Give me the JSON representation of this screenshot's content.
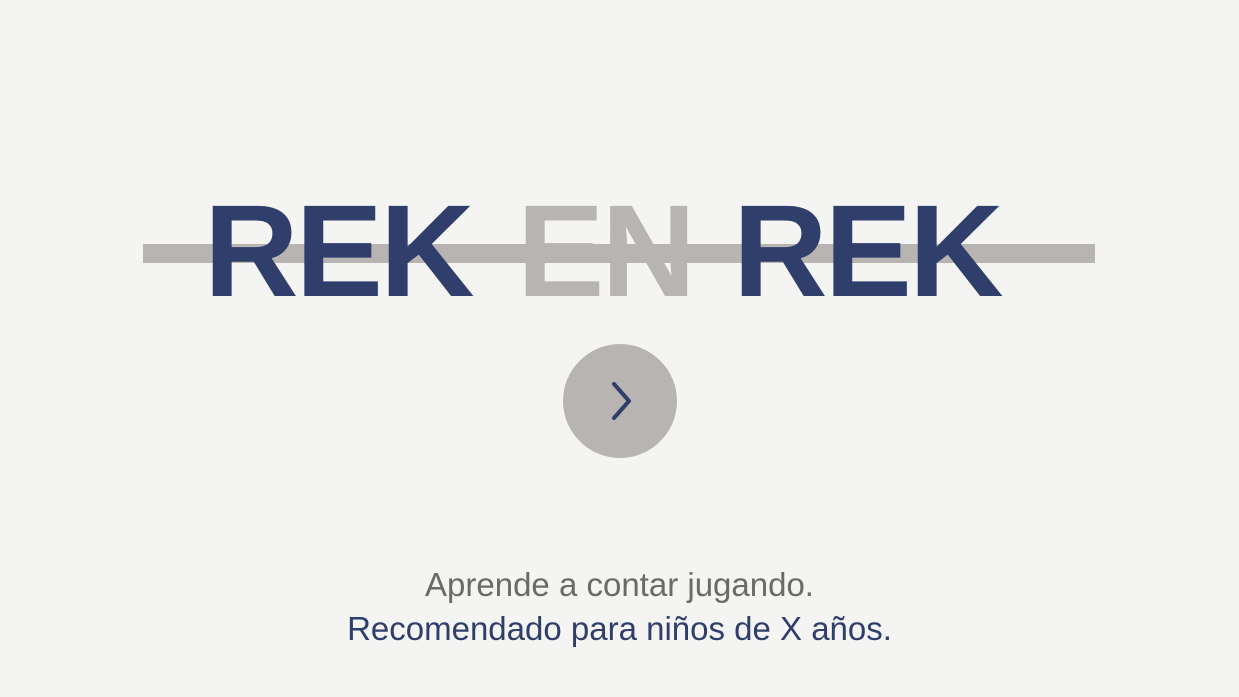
{
  "logo": {
    "word_left": "REK",
    "word_middle": "EN",
    "word_right": "REK"
  },
  "next_button": {
    "icon": "chevron-right-icon"
  },
  "tagline": {
    "line1": "Aprende a contar jugando.",
    "line2": "Recomendado para niños de X años."
  },
  "colors": {
    "background": "#f4f4f2",
    "navy": "#2f3e6b",
    "gray": "#b7b4b2",
    "text_gray": "#6b6a68"
  }
}
